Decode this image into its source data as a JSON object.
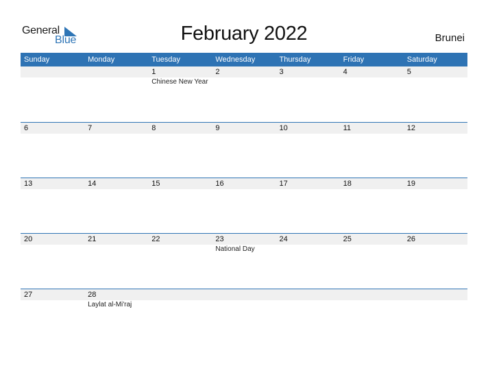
{
  "logo": {
    "line1": "General",
    "line2": "Blue"
  },
  "title": "February 2022",
  "country": "Brunei",
  "colors": {
    "header_bg": "#2e73b4",
    "logo_blue": "#2e75b6",
    "date_strip": "#f0f0f0"
  },
  "weekdays": [
    "Sunday",
    "Monday",
    "Tuesday",
    "Wednesday",
    "Thursday",
    "Friday",
    "Saturday"
  ],
  "weeks": [
    [
      {
        "day": "",
        "event": ""
      },
      {
        "day": "",
        "event": ""
      },
      {
        "day": "1",
        "event": "Chinese New Year"
      },
      {
        "day": "2",
        "event": ""
      },
      {
        "day": "3",
        "event": ""
      },
      {
        "day": "4",
        "event": ""
      },
      {
        "day": "5",
        "event": ""
      }
    ],
    [
      {
        "day": "6",
        "event": ""
      },
      {
        "day": "7",
        "event": ""
      },
      {
        "day": "8",
        "event": ""
      },
      {
        "day": "9",
        "event": ""
      },
      {
        "day": "10",
        "event": ""
      },
      {
        "day": "11",
        "event": ""
      },
      {
        "day": "12",
        "event": ""
      }
    ],
    [
      {
        "day": "13",
        "event": ""
      },
      {
        "day": "14",
        "event": ""
      },
      {
        "day": "15",
        "event": ""
      },
      {
        "day": "16",
        "event": ""
      },
      {
        "day": "17",
        "event": ""
      },
      {
        "day": "18",
        "event": ""
      },
      {
        "day": "19",
        "event": ""
      }
    ],
    [
      {
        "day": "20",
        "event": ""
      },
      {
        "day": "21",
        "event": ""
      },
      {
        "day": "22",
        "event": ""
      },
      {
        "day": "23",
        "event": "National Day"
      },
      {
        "day": "24",
        "event": ""
      },
      {
        "day": "25",
        "event": ""
      },
      {
        "day": "26",
        "event": ""
      }
    ],
    [
      {
        "day": "27",
        "event": ""
      },
      {
        "day": "28",
        "event": "Laylat al-Mi'raj"
      },
      {
        "day": "",
        "event": ""
      },
      {
        "day": "",
        "event": ""
      },
      {
        "day": "",
        "event": ""
      },
      {
        "day": "",
        "event": ""
      },
      {
        "day": "",
        "event": ""
      }
    ]
  ]
}
